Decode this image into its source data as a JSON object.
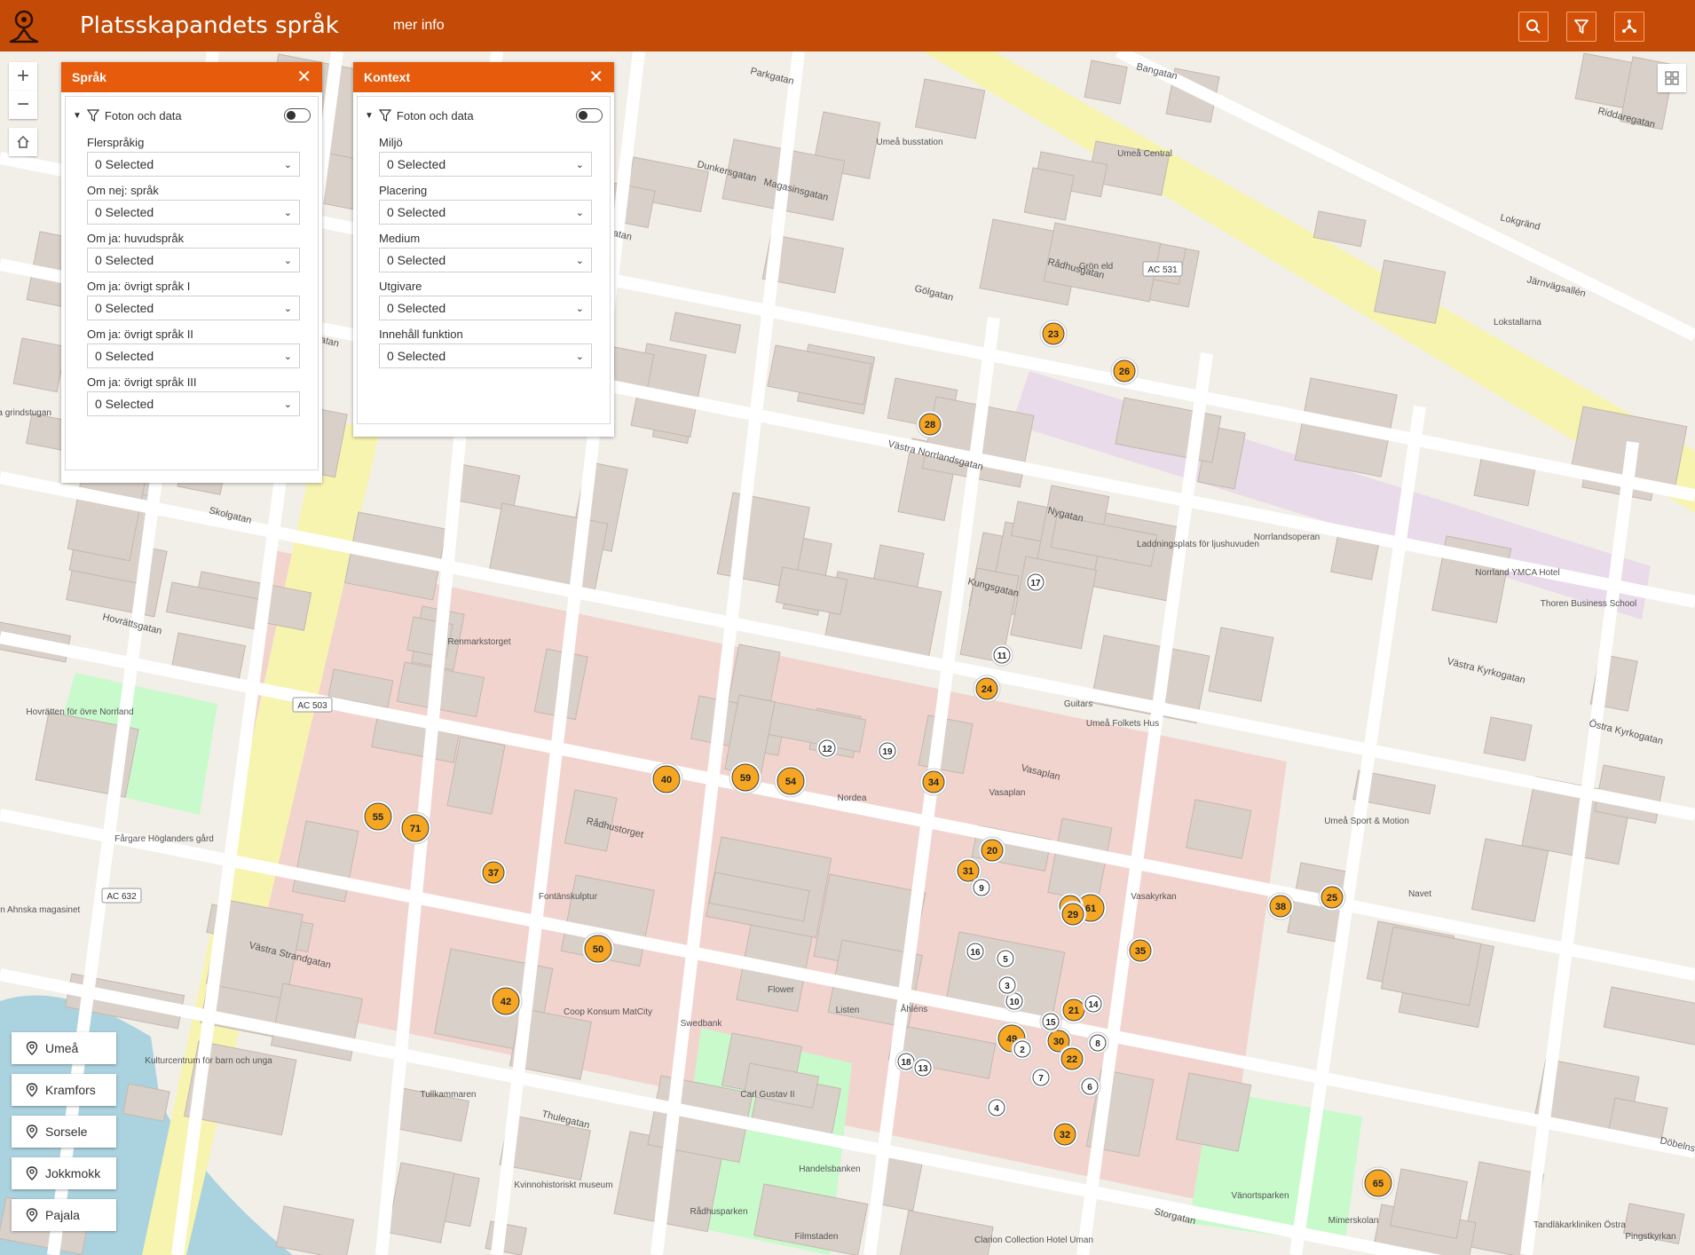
{
  "header": {
    "title": "Platsskapandets språk",
    "more_info": "mer info"
  },
  "map": {
    "zoom_in": "+",
    "zoom_out": "−",
    "streets": [
      {
        "name": "Parkgatan"
      },
      {
        "name": "Dunkersgatan"
      },
      {
        "name": "Magasinsgatan"
      },
      {
        "name": "Svedgatan"
      },
      {
        "name": "Gölgatan"
      },
      {
        "name": "Bankgatan"
      },
      {
        "name": "Rådhusgatan"
      },
      {
        "name": "Västra Norrlandsgatan"
      },
      {
        "name": "Skolgatan"
      },
      {
        "name": "Kungsgatan"
      },
      {
        "name": "Nygatan"
      },
      {
        "name": "Järnvägsallén"
      },
      {
        "name": "Riddaregatan"
      },
      {
        "name": "Storgatan"
      },
      {
        "name": "Västra Strandgatan"
      },
      {
        "name": "Västra Kyrkogatan"
      },
      {
        "name": "Östra Kyrkogatan"
      },
      {
        "name": "Vasaplan"
      },
      {
        "name": "Rådhustorget"
      },
      {
        "name": "Thulegatan"
      },
      {
        "name": "Hovrättsgatan"
      },
      {
        "name": "Bangatan"
      },
      {
        "name": "Lokgränd"
      },
      {
        "name": "Döbelnsgatan"
      }
    ],
    "places": [
      {
        "name": "Umeå Central"
      },
      {
        "name": "Rådhusparken"
      },
      {
        "name": "Vänortsparken"
      },
      {
        "name": "Umeå Folkets Hus"
      },
      {
        "name": "Lokstallarna"
      },
      {
        "name": "Norrlandsoperan"
      },
      {
        "name": "Kvinnohistoriskt museum"
      },
      {
        "name": "Filmstaden"
      },
      {
        "name": "Vasakyrkan"
      },
      {
        "name": "Handelsbanken"
      },
      {
        "name": "Carl Gustav II"
      },
      {
        "name": "Coop Konsum MatCity"
      },
      {
        "name": "Tullkammaren"
      },
      {
        "name": "Kulturcentrum för barn och unga"
      },
      {
        "name": "Hovrätten för övre Norrland"
      },
      {
        "name": "Umeå Sport & Motion"
      },
      {
        "name": "Navet"
      },
      {
        "name": "Guitars"
      },
      {
        "name": "Nordea"
      },
      {
        "name": "Åhléns"
      },
      {
        "name": "Grön eld"
      },
      {
        "name": "Umeå busstation"
      },
      {
        "name": "Vasaplan"
      },
      {
        "name": "Fontänskulptur"
      },
      {
        "name": "Swedbank"
      },
      {
        "name": "Flower"
      },
      {
        "name": "Listen"
      },
      {
        "name": "Clarion Collection Hotel Uman"
      },
      {
        "name": "Mimerskolan"
      },
      {
        "name": "Tandläkarkliniken Östra"
      },
      {
        "name": "Pingstkyrkan"
      },
      {
        "name": "Thoren Business School"
      },
      {
        "name": "Norrland YMCA Hotel"
      },
      {
        "name": "Laddningsplats för ljushuvuden"
      },
      {
        "name": "Fårgare Höglanders gård"
      },
      {
        "name": "von Ahnska magasinet"
      },
      {
        "name": "Västra grindstugan"
      },
      {
        "name": "Renmarkstorget"
      }
    ],
    "road_badges": [
      "AC 503",
      "AC 531",
      "AC 632"
    ],
    "clusters": [
      "71",
      "55",
      "50",
      "61",
      "42",
      "65",
      "59",
      "54",
      "49",
      "40",
      "38",
      "37",
      "35",
      "34",
      "33",
      "32",
      "31",
      "30",
      "29",
      "28",
      "26",
      "25",
      "24",
      "23",
      "22",
      "21",
      "20",
      "19",
      "18",
      "17",
      "16",
      "15",
      "14",
      "13",
      "12",
      "11",
      "10",
      "9",
      "8",
      "7",
      "6",
      "5",
      "4",
      "3",
      "2"
    ]
  },
  "panels": [
    {
      "title": "Språk",
      "filter_label": "Foton och data",
      "fields": [
        {
          "label": "Flerspråkig",
          "value": "0 Selected"
        },
        {
          "label": "Om nej: språk",
          "value": "0 Selected"
        },
        {
          "label": "Om ja: huvudspråk",
          "value": "0 Selected"
        },
        {
          "label": "Om ja: övrigt språk I",
          "value": "0 Selected"
        },
        {
          "label": "Om ja: övrigt språk II",
          "value": "0 Selected"
        },
        {
          "label": "Om ja: övrigt språk III",
          "value": "0 Selected"
        }
      ]
    },
    {
      "title": "Kontext",
      "filter_label": "Foton och data",
      "fields": [
        {
          "label": "Miljö",
          "value": "0 Selected"
        },
        {
          "label": "Placering",
          "value": "0 Selected"
        },
        {
          "label": "Medium",
          "value": "0 Selected"
        },
        {
          "label": "Utgivare",
          "value": "0 Selected"
        },
        {
          "label": "Innehåll funktion",
          "value": "0 Selected"
        }
      ]
    }
  ],
  "locations": [
    "Umeå",
    "Kramfors",
    "Sorsele",
    "Jokkmokk",
    "Pajala"
  ],
  "colors": {
    "header": "#c44a07",
    "panel_header": "#e65b0c",
    "cluster_fill": "#f5a623"
  }
}
